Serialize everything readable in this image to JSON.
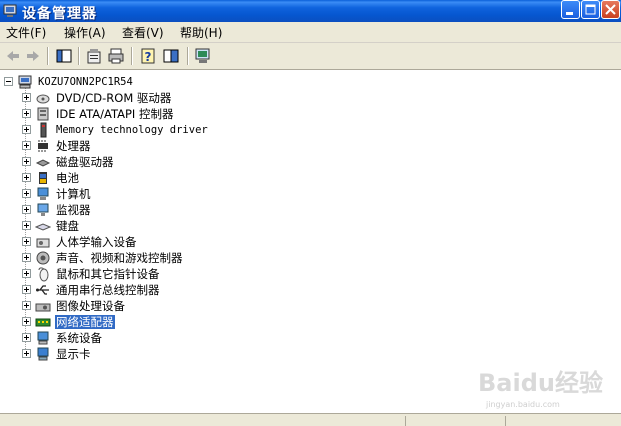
{
  "window": {
    "title": "设备管理器"
  },
  "menu": [
    {
      "label": "文件(F)"
    },
    {
      "label": "操作(A)"
    },
    {
      "label": "查看(V)"
    },
    {
      "label": "帮助(H)"
    }
  ],
  "toolbar": {
    "icons": [
      "back-arrow-icon",
      "forward-arrow-icon",
      "console-tree-icon",
      "properties-icon",
      "print-icon",
      "help-icon",
      "show-hide-pane-icon",
      "scan-hardware-icon"
    ]
  },
  "tree": {
    "root": {
      "label": "KOZU7ONN2PC1R54",
      "icon": "computer-icon"
    },
    "items": [
      {
        "label": "DVD/CD-ROM 驱动器",
        "icon": "cdrom-icon"
      },
      {
        "label": "IDE ATA/ATAPI 控制器",
        "icon": "ide-controller-icon"
      },
      {
        "label": "Memory technology driver",
        "icon": "memory-icon"
      },
      {
        "label": "处理器",
        "icon": "processor-icon"
      },
      {
        "label": "磁盘驱动器",
        "icon": "disk-drive-icon"
      },
      {
        "label": "电池",
        "icon": "battery-icon"
      },
      {
        "label": "计算机",
        "icon": "computer-monitor-icon"
      },
      {
        "label": "监视器",
        "icon": "monitor-icon"
      },
      {
        "label": "键盘",
        "icon": "keyboard-icon"
      },
      {
        "label": "人体学输入设备",
        "icon": "hid-icon"
      },
      {
        "label": "声音、视频和游戏控制器",
        "icon": "sound-icon"
      },
      {
        "label": "鼠标和其它指针设备",
        "icon": "mouse-icon"
      },
      {
        "label": "通用串行总线控制器",
        "icon": "usb-icon"
      },
      {
        "label": "图像处理设备",
        "icon": "imaging-icon"
      },
      {
        "label": "网络适配器",
        "icon": "network-adapter-icon",
        "selected": true
      },
      {
        "label": "系统设备",
        "icon": "system-devices-icon"
      },
      {
        "label": "显示卡",
        "icon": "display-adapter-icon"
      }
    ]
  },
  "watermark": {
    "brand": "Baidu经验",
    "url": "jingyan.baidu.com"
  }
}
